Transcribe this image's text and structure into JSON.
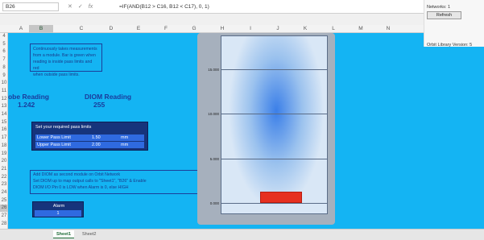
{
  "formula_bar": {
    "name_box": "B26",
    "icons": [
      "cancel-icon",
      "enter-icon",
      "function-icon"
    ],
    "formula": "=IF(AND(B12 > C16, B12 < C17), 0, 1)"
  },
  "columns": [
    "A",
    "B",
    "C",
    "D",
    "E",
    "F",
    "G",
    "H",
    "I",
    "J",
    "K",
    "L",
    "M",
    "N"
  ],
  "rows": [
    "4",
    "5",
    "6",
    "7",
    "8",
    "9",
    "10",
    "11",
    "12",
    "13",
    "14",
    "15",
    "16",
    "17",
    "18",
    "19",
    "20",
    "21",
    "22",
    "23",
    "24",
    "25",
    "26",
    "27",
    "28"
  ],
  "selected_cell": {
    "column": "B",
    "row": "26"
  },
  "info_text": [
    "Continuously takes measurements",
    "from a module.  Bar is green when",
    "reading is inside pass limits and red",
    "when outside pass limits."
  ],
  "probe": {
    "label": "Probe Reading",
    "value": "1.242"
  },
  "diom": {
    "label": "DIOM Reading",
    "value": "255"
  },
  "limits": {
    "title": "Set your required pass limits",
    "lower": {
      "label": "Lower Pass Limit",
      "value": "1.50",
      "unit": "mm"
    },
    "upper": {
      "label": "Upper Pass Limit",
      "value": "2.00",
      "unit": "mm"
    }
  },
  "network_text": [
    "Add DIOM as second module on Orbit Network",
    "Set DIOM up to map output calls to \"Sheet1\", \"B26\" & Enable",
    "DIOM I/O Pin 0 is LOW when Alarm is 0, else HIGH"
  ],
  "alarm": {
    "label": "Alarm",
    "value": "1"
  },
  "chart_data": {
    "type": "bar",
    "categories": [
      ""
    ],
    "values": [
      1.242
    ],
    "ylim": [
      0,
      20
    ],
    "yticks": [
      "0.000",
      "5.000",
      "10.000",
      "15.000",
      "20.000"
    ],
    "bar_color": "#e63020",
    "grid": true
  },
  "side_panel": {
    "networks_label": "Networks:",
    "networks_value": "1",
    "refresh_label": "Refresh",
    "version_label": "Orbit Library Version: 5"
  },
  "tabs": [
    "Sheet1",
    "Sheet2"
  ],
  "colors": {
    "sheet_bg": "#14b4f3",
    "panel_dark": "#16347c",
    "panel_row": "#2f6ae0",
    "text_blue": "#1a3c9c"
  }
}
